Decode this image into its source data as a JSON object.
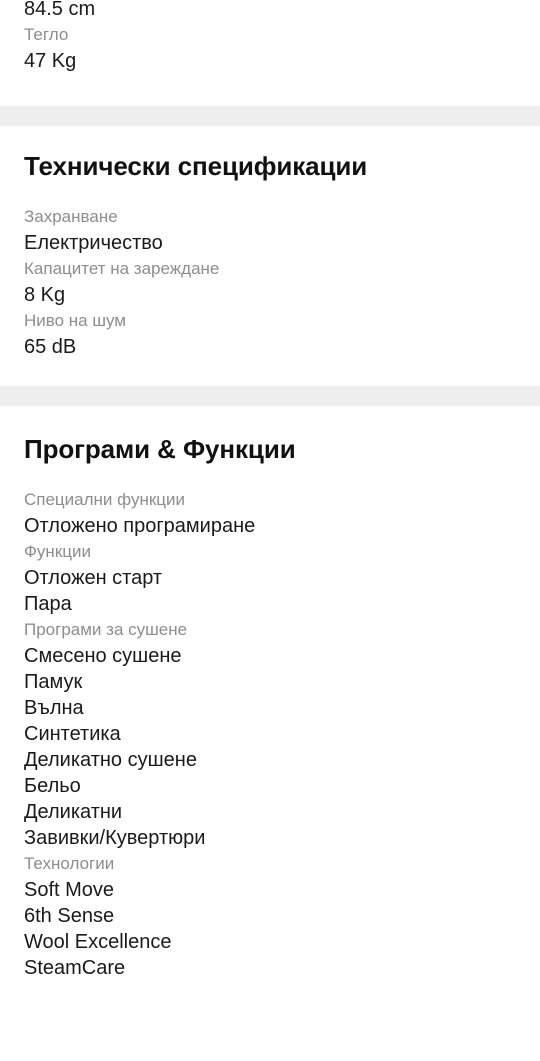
{
  "page": {
    "background_color": "#ffffff",
    "divider_band_color": "#eeeeee",
    "label_color": "#8d8d8d",
    "value_color": "#1a1a1a"
  },
  "sections": [
    {
      "id": "dimensions",
      "title": null,
      "clipped_top_value": "84.5 cm",
      "groups": [
        {
          "label": "Тегло",
          "values": [
            "47 Kg"
          ]
        }
      ]
    },
    {
      "id": "technical",
      "title": "Технически спецификации",
      "groups": [
        {
          "label": "Захранване",
          "values": [
            "Електричество"
          ]
        },
        {
          "label": "Капацитет на зареждане",
          "values": [
            "8 Kg"
          ]
        },
        {
          "label": "Ниво на шум",
          "values": [
            "65 dB"
          ]
        }
      ]
    },
    {
      "id": "programs",
      "title": "Програми & Функции",
      "groups": [
        {
          "label": "Специални функции",
          "values": [
            "Отложено програмиране"
          ]
        },
        {
          "label": "Функции",
          "values": [
            "Отложен старт",
            "Пара"
          ]
        },
        {
          "label": "Програми за сушене",
          "values": [
            "Смесено сушене",
            "Памук",
            "Вълна",
            "Синтетика",
            "Деликатно сушене",
            "Бельо",
            "Деликатни",
            "Завивки/Кувертюри"
          ]
        },
        {
          "label": "Технологии",
          "values": [
            "Soft Move",
            "6th Sense",
            "Wool Excellence",
            "SteamCare"
          ]
        }
      ]
    }
  ]
}
